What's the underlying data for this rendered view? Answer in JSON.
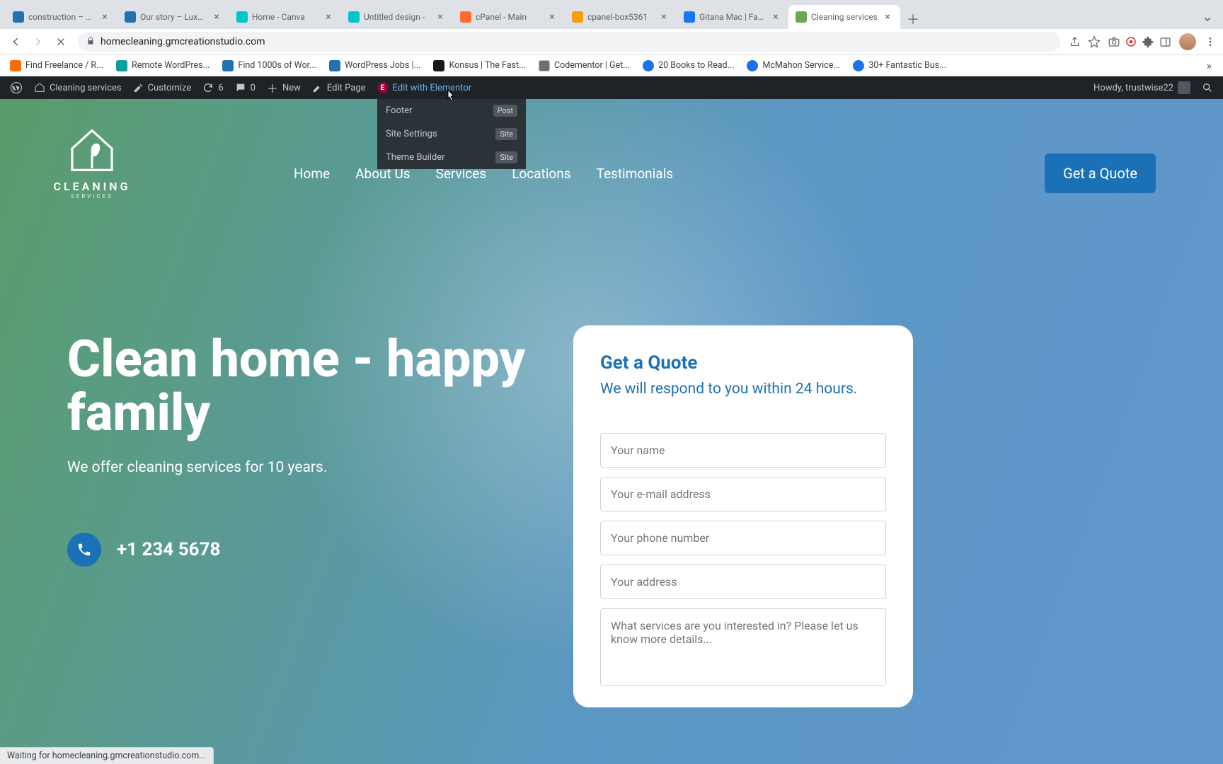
{
  "browser": {
    "tabs": [
      {
        "title": "construction – Av",
        "favicon": "#2271b1"
      },
      {
        "title": "Our story – Luxpa",
        "favicon": "#2271b1"
      },
      {
        "title": "Home - Canva",
        "favicon": "#00c4cc"
      },
      {
        "title": "Untitled design -",
        "favicon": "#00c4cc"
      },
      {
        "title": "cPanel - Main",
        "favicon": "#ff6c2c"
      },
      {
        "title": "cpanel-box5361",
        "favicon": "#f89c0e"
      },
      {
        "title": "Gitana Mac | Face",
        "favicon": "#1877f2"
      },
      {
        "title": "Cleaning services",
        "favicon": "#6aa84f",
        "active": true
      }
    ],
    "url": "homecleaning.gmcreationstudio.com",
    "bookmarks": [
      {
        "label": "Find Freelance / R...",
        "color": "#ff6b00"
      },
      {
        "label": "Remote WordPres...",
        "color": "#0f9d9f"
      },
      {
        "label": "Find 1000s of Wor...",
        "color": "#2271b1"
      },
      {
        "label": "WordPress Jobs |...",
        "color": "#2271b1"
      },
      {
        "label": "Konsus | The Fast...",
        "color": "#1a1a1a"
      },
      {
        "label": "Codementor | Get...",
        "color": "#6e6e6e"
      },
      {
        "label": "20 Books to Read...",
        "color": "#1a73e8"
      },
      {
        "label": "McMahon Service...",
        "color": "#1a73e8"
      },
      {
        "label": "30+ Fantastic Bus...",
        "color": "#1a73e8"
      }
    ]
  },
  "wp_bar": {
    "site_name": "Cleaning services",
    "customize": "Customize",
    "updates": "6",
    "comments": "0",
    "new": "New",
    "edit_page": "Edit Page",
    "edit_elementor": "Edit with Elementor",
    "howdy": "Howdy, trustwise22",
    "dropdown": [
      {
        "label": "Footer",
        "badge": "Post"
      },
      {
        "label": "Site Settings",
        "badge": "Site"
      },
      {
        "label": "Theme Builder",
        "badge": "Site"
      }
    ]
  },
  "page": {
    "logo_main": "CLEANING",
    "logo_sub": "SERVICES",
    "nav": [
      "Home",
      "About Us",
      "Services",
      "Locations",
      "Testimonials"
    ],
    "quote_button": "Get a Quote",
    "hero_title": "Clean home - happy family",
    "hero_sub": "We offer cleaning services for 10 years.",
    "phone": "+1 234 5678",
    "form": {
      "title": "Get a Quote",
      "subtitle": "We will respond to you within 24 hours.",
      "name_ph": "Your name",
      "email_ph": "Your e-mail address",
      "phone_ph": "Your phone number",
      "address_ph": "Your address",
      "message_ph": "What services are you interested in? Please let us know more details..."
    }
  },
  "status": "Waiting for homecleaning.gmcreationstudio.com..."
}
